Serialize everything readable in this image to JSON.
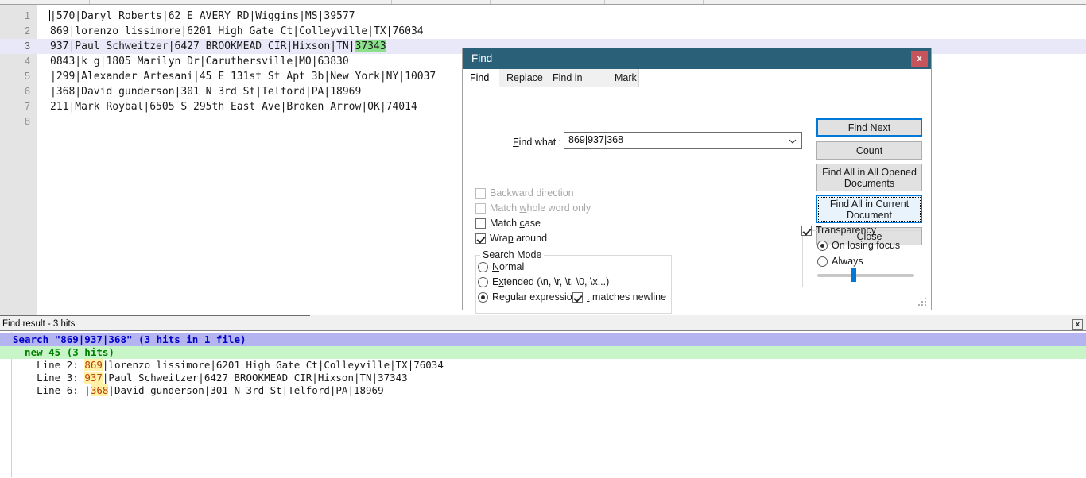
{
  "editor": {
    "lines": [
      {
        "n": "1",
        "text": "|570|Daryl Roberts|62 E AVERY RD|Wiggins|MS|39577"
      },
      {
        "n": "2",
        "text": "869|lorenzo lissimore|6201 High Gate Ct|Colleyville|TX|76034"
      },
      {
        "n": "3",
        "text": "937|Paul Schweitzer|6427 BROOKMEAD CIR|Hixson|TN|",
        "highlight": "37343"
      },
      {
        "n": "4",
        "text": "0843|k g|1805 Marilyn Dr|Caruthersville|MO|63830"
      },
      {
        "n": "5",
        "text": "|299|Alexander Artesani|45 E 131st St Apt 3b|New York|NY|10037"
      },
      {
        "n": "6",
        "text": "|368|David gunderson|301 N 3rd St|Telford|PA|18969"
      },
      {
        "n": "7",
        "text": "211|Mark Roybal|6505 S 295th East Ave|Broken Arrow|OK|74014"
      },
      {
        "n": "8",
        "text": ""
      }
    ]
  },
  "dialog": {
    "title": "Find",
    "close_label": "x",
    "tabs": [
      {
        "label": "Find",
        "selected": true
      },
      {
        "label": "Replace",
        "selected": false
      },
      {
        "label": "Find in Files",
        "selected": false
      },
      {
        "label": "Mark",
        "selected": false
      }
    ],
    "find_what_label": "Find what :",
    "find_what_value": "869|937|368",
    "buttons": {
      "find_next": "Find Next",
      "count": "Count",
      "find_all_opened_1": "Find All in All Opened",
      "find_all_opened_2": "Documents",
      "find_all_current_1": "Find All in Current",
      "find_all_current_2": "Document",
      "close": "Close"
    },
    "options": [
      {
        "label": "Backward direction",
        "checked": false,
        "disabled": true
      },
      {
        "label": "Match whole word only",
        "checked": false,
        "disabled": true
      },
      {
        "label": "Match case",
        "checked": false,
        "disabled": false
      },
      {
        "label": "Wrap around",
        "checked": true,
        "disabled": false
      }
    ],
    "search_mode": {
      "title": "Search Mode",
      "items": [
        {
          "label": "Normal",
          "selected": false
        },
        {
          "label": "Extended (\\n, \\r, \\t, \\0, \\x...)",
          "selected": false
        },
        {
          "label": "Regular expression",
          "selected": true
        }
      ],
      "dot_matches_newline": {
        "label": ". matches newline",
        "checked": true
      }
    },
    "transparency": {
      "label": "Transparency",
      "checked": true,
      "items": [
        {
          "label": "On losing focus",
          "selected": true
        },
        {
          "label": "Always",
          "selected": false
        }
      ],
      "slider_percent": 37
    }
  },
  "find_result": {
    "header": "Find result - 3 hits",
    "close_label": "x",
    "search_line": "Search \"869|937|368\" (3 hits in 1 file)",
    "file_line": "  new 45 (3 hits)",
    "hits": [
      {
        "prefix": "    Line 2: ",
        "match": "869",
        "rest": "|lorenzo lissimore|6201 High Gate Ct|Colleyville|TX|76034"
      },
      {
        "prefix": "    Line 3: ",
        "match": "937",
        "rest": "|Paul Schweitzer|6427 BROOKMEAD CIR|Hixson|TN|37343"
      },
      {
        "prefix": "    Line 6: |",
        "match": "368",
        "rest": "|David gunderson|301 N 3rd St|Telford|PA|18969"
      }
    ]
  },
  "colors": {
    "title_bar": "#2b6079",
    "close_button": "#c5555a",
    "accent": "#0078d7",
    "search_row": "#b4b4f0",
    "file_row": "#c8f5c8",
    "match_highlight": "#fff2a8",
    "editor_highlight": "#8ce08c",
    "current_line": "#e8e8f8"
  }
}
